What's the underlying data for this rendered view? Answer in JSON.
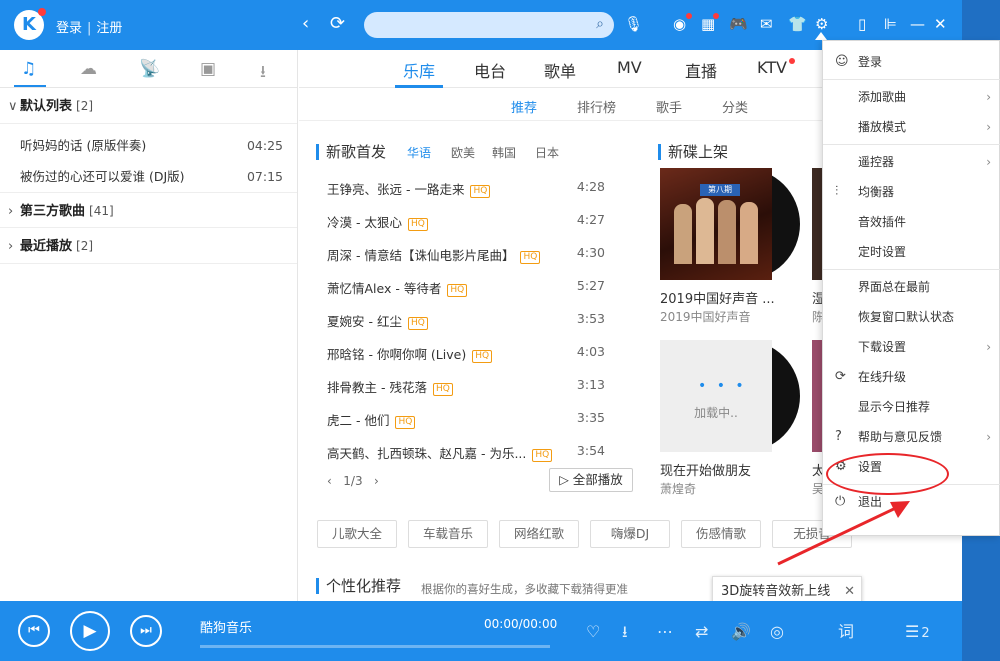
{
  "topbar": {
    "logo": "K",
    "login": "登录",
    "register": "注册",
    "back": "‹",
    "refresh": "⟳",
    "search_placeholder": "",
    "search_icon": "⌕",
    "mic": "🎙",
    "icons": {
      "radar": "◉",
      "apps": "▦",
      "game": "🎮",
      "mail": "✉",
      "skin": "👕",
      "settings": "⚙",
      "mobile": "▯",
      "mini": "⊫",
      "minimize": "—",
      "close": "✕"
    }
  },
  "left": {
    "tabs": [
      "♫",
      "☁",
      "📡",
      "▣",
      "⭳"
    ],
    "groups": [
      {
        "name": "默认列表",
        "count": "[2]",
        "expanded": true,
        "songs": [
          {
            "title": "听妈妈的话 (原版伴奏)",
            "duration": "04:25"
          },
          {
            "title": "被伤过的心还可以爱谁 (DJ版)",
            "duration": "07:15"
          }
        ]
      },
      {
        "name": "第三方歌曲",
        "count": "[41]",
        "expanded": false,
        "songs": []
      },
      {
        "name": "最近播放",
        "count": "[2]",
        "expanded": false,
        "songs": []
      }
    ]
  },
  "main": {
    "tabs": [
      "乐库",
      "电台",
      "歌单",
      "MV",
      "直播",
      "KTV"
    ],
    "subtabs": [
      "推荐",
      "排行榜",
      "歌手",
      "分类"
    ],
    "new_songs": {
      "title": "新歌首发",
      "langs": [
        "华语",
        "欧美",
        "韩国",
        "日本"
      ],
      "hq_label": "HQ",
      "songs": [
        {
          "title": "王铮亮、张远 - 一路走来",
          "duration": "4:28"
        },
        {
          "title": "冷漠 - 太狠心",
          "duration": "4:27"
        },
        {
          "title": "周深 - 情意结【诛仙电影片尾曲】",
          "duration": "4:30"
        },
        {
          "title": "萧忆情Alex - 等待者",
          "duration": "5:27"
        },
        {
          "title": "夏婉安 - 红尘",
          "duration": "3:53"
        },
        {
          "title": "邢晗铭 - 你啊你啊 (Live)",
          "duration": "4:03"
        },
        {
          "title": "排骨教主 - 残花落",
          "duration": "3:13"
        },
        {
          "title": "虎二 - 他们",
          "duration": "3:35"
        },
        {
          "title": "高天鹤、扎西顿珠、赵凡嘉 - 为乐...",
          "duration": "3:54"
        }
      ],
      "pager": "1/3",
      "play_all": "▷ 全部播放"
    },
    "new_albums": {
      "title": "新碟上架",
      "items": [
        {
          "name": "2019中国好声音 ...",
          "artist": "2019中国好声音",
          "cover_text": "第八期"
        },
        {
          "name": "现在开始做朋友",
          "artist": "萧煌奇",
          "cover_text": "加载中.."
        }
      ],
      "peek": [
        {
          "name": "湿",
          "artist": "陈"
        },
        {
          "name": "太",
          "artist": "吴"
        }
      ]
    },
    "tags": [
      "儿歌大全",
      "车载音乐",
      "网络红歌",
      "嗨爆DJ",
      "伤感情歌",
      "无损音"
    ],
    "personal": {
      "title": "个性化推荐",
      "desc": "根据你的喜好生成，多收藏下载猜得更准"
    }
  },
  "toast": {
    "text": "3D旋转音效新上线",
    "close": "✕"
  },
  "player": {
    "prev": "⏮",
    "play": "▶",
    "next": "⏭",
    "title": "酷狗音乐",
    "time": "00:00/00:00",
    "progress": 0,
    "icons": {
      "like": "♡",
      "download": "⭳",
      "more": "⋯",
      "loop": "⇄",
      "volume": "🔊",
      "lyric": "词",
      "queue": "☰",
      "queue_count": "2"
    }
  },
  "menu": {
    "items": [
      {
        "label": "登录",
        "icon": "☺",
        "has_sub": false,
        "sep_after": true
      },
      {
        "label": "添加歌曲",
        "icon": "",
        "has_sub": true,
        "sep_after": false
      },
      {
        "label": "播放模式",
        "icon": "",
        "has_sub": true,
        "sep_after": true
      },
      {
        "label": "遥控器",
        "icon": "",
        "has_sub": true,
        "sep_after": false
      },
      {
        "label": "均衡器",
        "icon": "⫶",
        "has_sub": false,
        "sep_after": false
      },
      {
        "label": "音效插件",
        "icon": "",
        "has_sub": false,
        "sep_after": false
      },
      {
        "label": "定时设置",
        "icon": "",
        "has_sub": false,
        "sep_after": true
      },
      {
        "label": "界面总在最前",
        "icon": "",
        "has_sub": false,
        "sep_after": false
      },
      {
        "label": "恢复窗口默认状态",
        "icon": "",
        "has_sub": false,
        "sep_after": false
      },
      {
        "label": "下载设置",
        "icon": "",
        "has_sub": true,
        "sep_after": false
      },
      {
        "label": "在线升级",
        "icon": "⟳",
        "has_sub": false,
        "sep_after": false
      },
      {
        "label": "显示今日推荐",
        "icon": "",
        "has_sub": false,
        "sep_after": false
      },
      {
        "label": "帮助与意见反馈",
        "icon": "?",
        "has_sub": true,
        "sep_after": false
      },
      {
        "label": "设置",
        "icon": "⚙",
        "has_sub": false,
        "sep_after": true
      },
      {
        "label": "退出",
        "icon": "⏻",
        "has_sub": false,
        "sep_after": false
      }
    ],
    "sub_arrow": "›"
  },
  "colors": {
    "brand": "#1f8ceb",
    "annotation": "#e8262a"
  }
}
